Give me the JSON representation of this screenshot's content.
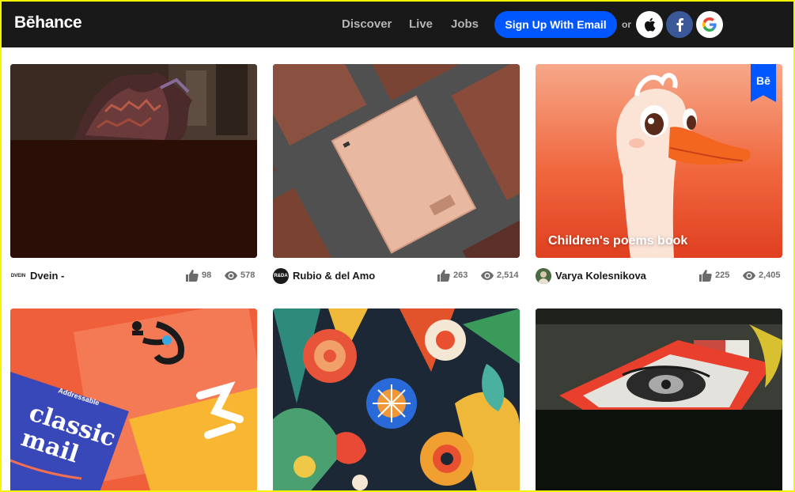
{
  "header": {
    "logo": "Bēhance",
    "nav": [
      "Discover",
      "Live",
      "Jobs"
    ],
    "signup_label": "Sign Up With Email",
    "or_label": "or",
    "social": [
      "apple-icon",
      "facebook-icon",
      "google-icon"
    ]
  },
  "projects": [
    {
      "owner": "Dvein -",
      "owner_avatar_text": "DVEIN",
      "appreciations": "98",
      "views": "578",
      "thumb_title": ""
    },
    {
      "owner": "Rubio & del Amo",
      "owner_avatar_text": "R&DA",
      "appreciations": "263",
      "views": "2,514",
      "thumb_title": ""
    },
    {
      "owner": "Varya Kolesnikova",
      "owner_avatar_text": "",
      "appreciations": "225",
      "views": "2,405",
      "thumb_title": "Children's poems book",
      "badge": "Bē"
    },
    {
      "thumb_text_1": "Addressable",
      "thumb_text_2": "classic",
      "thumb_text_3": "mail"
    },
    {},
    {}
  ],
  "colors": {
    "topbar": "#191919",
    "brand_blue": "#0057ff",
    "nav_text": "#b5b5b5",
    "stat_text": "#707070"
  }
}
